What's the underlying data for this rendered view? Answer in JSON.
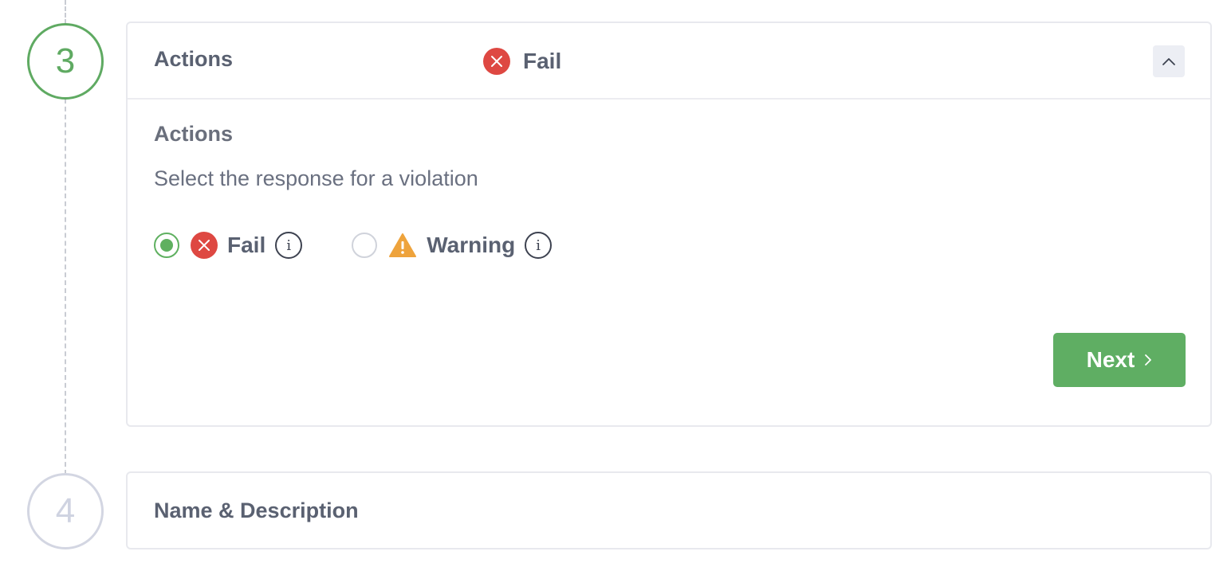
{
  "steps": [
    {
      "number": "3",
      "state": "active"
    },
    {
      "number": "4",
      "state": "inactive"
    }
  ],
  "actions_card": {
    "title": "Actions",
    "status_icon": "error-circle-icon",
    "status_text": "Fail",
    "collapse_icon": "chevron-up-icon",
    "section_label": "Actions",
    "description": "Select the response for a violation",
    "options": [
      {
        "label": "Fail",
        "icon": "error-circle-icon",
        "selected": true
      },
      {
        "label": "Warning",
        "icon": "warning-triangle-icon",
        "selected": false
      }
    ],
    "info_glyph": "i",
    "next_button": {
      "label": "Next",
      "icon": "chevron-right-icon"
    }
  },
  "name_card": {
    "title": "Name & Description"
  },
  "colors": {
    "accent_green": "#5faa62",
    "error_red": "#de4842",
    "warning_orange": "#eea33c",
    "inactive_step": "#d3d6e2"
  }
}
